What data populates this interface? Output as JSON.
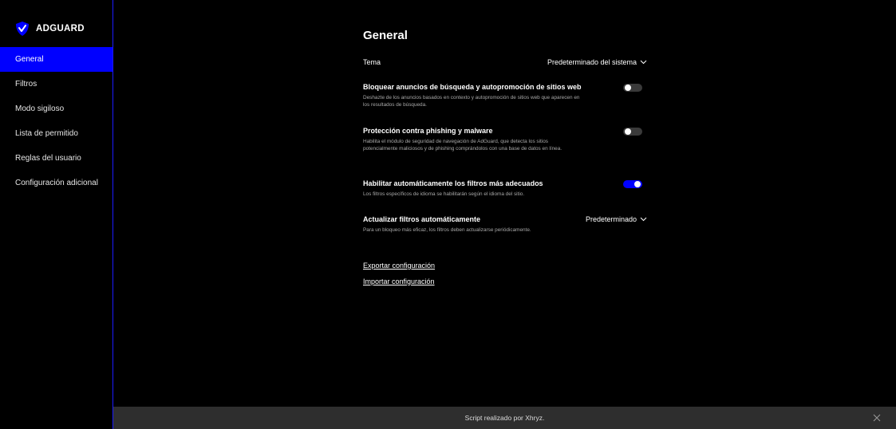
{
  "app": {
    "name": "ADGUARD",
    "brand_color": "#0000ff"
  },
  "sidebar": {
    "items": [
      {
        "label": "General",
        "active": true
      },
      {
        "label": "Filtros",
        "active": false
      },
      {
        "label": "Modo sigiloso",
        "active": false
      },
      {
        "label": "Lista de permitido",
        "active": false
      },
      {
        "label": "Reglas del usuario",
        "active": false
      },
      {
        "label": "Configuración adicional",
        "active": false
      }
    ]
  },
  "main": {
    "title": "General",
    "theme": {
      "label": "Tema",
      "value": "Predeterminado del sistema"
    },
    "search_ads": {
      "title": "Bloquear anuncios de búsqueda y autopromoción de sitios web",
      "description": "Deshazte de los anuncios basados en contexto y autopromoción de sitios web que aparecen en los resultados de búsqueda.",
      "enabled": false
    },
    "phishing": {
      "title": "Protección contra phishing y malware",
      "description": "Habilita el módulo de seguridad de navegación de AdGuard, que detecta los sitios potencialmente maliciosos y de phishing comprándolos con una base de datos en línea.",
      "enabled": false
    },
    "auto_filters": {
      "title": "Habilitar automáticamente los filtros más adecuados",
      "description": "Los filtros específicos de idioma se habilitarán según el idioma del sitio.",
      "enabled": true
    },
    "update_filters": {
      "title": "Actualizar filtros automáticamente",
      "description": "Para un bloqueo más eficaz, los filtros deben actualizarse periódicamente.",
      "value": "Predeterminado"
    },
    "export_label": "Exportar configuración",
    "import_label": "Importar configuración"
  },
  "footer": {
    "text": "Script realizado por Xhryz."
  }
}
